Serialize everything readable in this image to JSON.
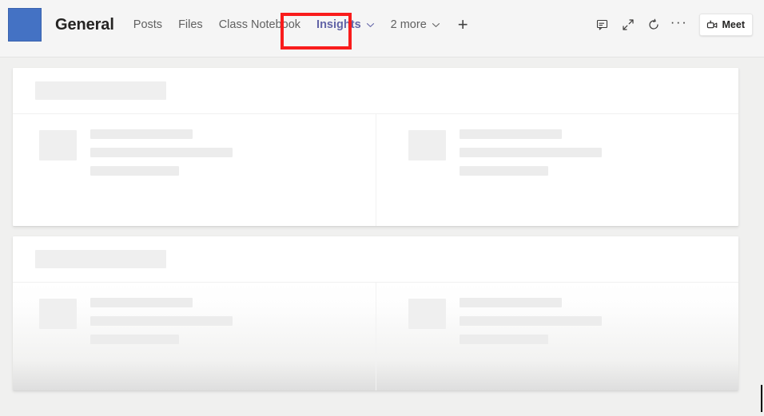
{
  "header": {
    "avatar": {
      "name": "team-avatar",
      "color": "#4472C4"
    },
    "channel_title": "General",
    "tabs": [
      {
        "label": "Posts",
        "active": false,
        "has_chevron": false
      },
      {
        "label": "Files",
        "active": false,
        "has_chevron": false
      },
      {
        "label": "Class Notebook",
        "active": false,
        "has_chevron": false
      },
      {
        "label": "Insights",
        "active": true,
        "has_chevron": true
      },
      {
        "label": "2 more",
        "active": false,
        "has_chevron": true
      }
    ],
    "add_tab_label": "+",
    "actions": [
      {
        "name": "chat-icon",
        "label": "Chat"
      },
      {
        "name": "expand-icon",
        "label": "Expand"
      },
      {
        "name": "refresh-icon",
        "label": "Refresh"
      },
      {
        "name": "more-options-icon",
        "label": "···"
      }
    ],
    "meet_button": {
      "label": "Meet",
      "icon": "video-camera-icon"
    },
    "active_tab_color": "#6264A7",
    "annotation": {
      "name": "red-highlight-box",
      "color": "#F91C1C",
      "target": "Insights"
    }
  },
  "content": {
    "background": "#F0F0EF",
    "cards": [
      {
        "name": "insights-card-1",
        "state": "loading",
        "skeleton": {
          "title_placeholder": true,
          "panels": [
            {
              "thumbnail": true,
              "lines": 3
            },
            {
              "thumbnail": true,
              "lines": 3
            }
          ]
        }
      },
      {
        "name": "insights-card-2",
        "state": "loading",
        "skeleton": {
          "title_placeholder": true,
          "panels": [
            {
              "thumbnail": true,
              "lines": 3
            },
            {
              "thumbnail": true,
              "lines": 3
            }
          ]
        }
      }
    ]
  }
}
